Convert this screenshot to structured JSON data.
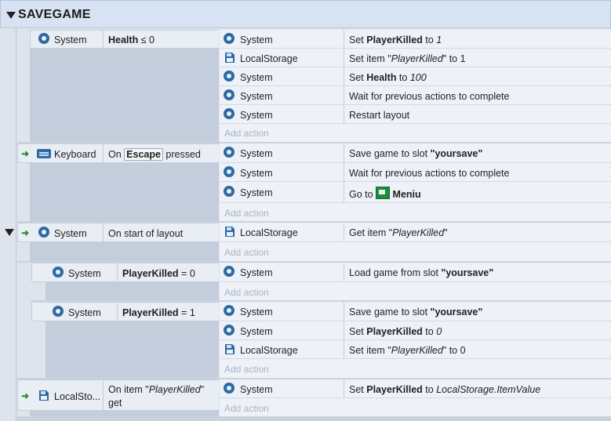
{
  "group": {
    "title": "SAVEGAME"
  },
  "events": [
    {
      "cond_object": "System",
      "cond_text": "Health ≤ 0",
      "actions": [
        {
          "object": "System",
          "text": "Set PlayerKilled to 1"
        },
        {
          "object": "LocalStorage",
          "text": "Set item \"PlayerKilled\" to 1"
        },
        {
          "object": "System",
          "text": "Set Health to 100"
        },
        {
          "object": "System",
          "text": "Wait for previous actions to complete"
        },
        {
          "object": "System",
          "text": "Restart layout"
        }
      ]
    },
    {
      "cond_object": "Keyboard",
      "cond_text": "On Escape pressed",
      "actions": [
        {
          "object": "System",
          "text": "Save game to slot \"yoursave\""
        },
        {
          "object": "System",
          "text": "Wait for previous actions to complete"
        },
        {
          "object": "System",
          "text": "Go to Meniu"
        }
      ]
    },
    {
      "cond_object": "System",
      "cond_text": "On start of layout",
      "actions": [
        {
          "object": "LocalStorage",
          "text": "Get item \"PlayerKilled\""
        }
      ]
    },
    {
      "cond_object": "System",
      "cond_text": "PlayerKilled = 0",
      "actions": [
        {
          "object": "System",
          "text": "Load game from slot \"yoursave\""
        }
      ]
    },
    {
      "cond_object": "System",
      "cond_text": "PlayerKilled = 1",
      "actions": [
        {
          "object": "System",
          "text": "Save game to slot \"yoursave\""
        },
        {
          "object": "System",
          "text": "Set PlayerKilled to 0"
        },
        {
          "object": "LocalStorage",
          "text": "Set item \"PlayerKilled\" to 0"
        }
      ]
    },
    {
      "cond_object": "LocalSto...",
      "cond_text": "On item \"PlayerKilled\" get",
      "actions": [
        {
          "object": "System",
          "text": "Set PlayerKilled to LocalStorage.ItemValue"
        }
      ]
    }
  ],
  "add_action_label": "Add action",
  "icons": {
    "system": "gear-icon",
    "localstorage": "local-storage-icon",
    "keyboard": "keyboard-icon",
    "trigger": "trigger-arrow-icon",
    "collapse": "collapse-triangle-icon",
    "layout": "layout-icon"
  },
  "colors": {
    "header_bg": "#d7e3f3",
    "gear_blue": "#2d6aa3",
    "trigger_green": "#2f8a3a",
    "layout_green": "#1d8c3c"
  }
}
